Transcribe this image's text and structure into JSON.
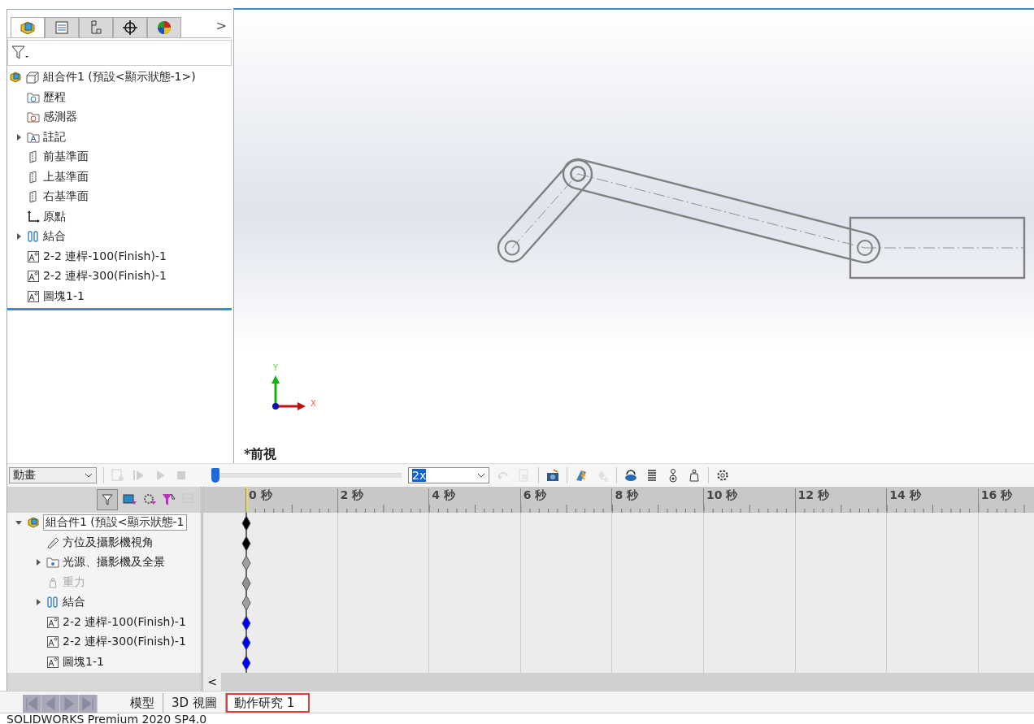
{
  "feature_manager": {
    "tabs": [
      {
        "kind": "feature",
        "selected": true
      },
      {
        "kind": "property",
        "selected": false
      },
      {
        "kind": "config",
        "selected": false
      },
      {
        "kind": "dimxpert",
        "selected": false
      },
      {
        "kind": "display",
        "selected": false
      }
    ],
    "more": ">",
    "tree": [
      {
        "kind": "assembly",
        "label": "組合件1  (預設<顯示狀態-1>)",
        "children": [
          {
            "kind": "history",
            "label": "歷程"
          },
          {
            "kind": "sensor",
            "label": "感測器"
          },
          {
            "kind": "annotation",
            "label": "註記",
            "expanded": false
          },
          {
            "kind": "plane",
            "label": "前基準面"
          },
          {
            "kind": "plane",
            "label": "上基準面"
          },
          {
            "kind": "plane",
            "label": "右基準面"
          },
          {
            "kind": "origin",
            "label": "原點"
          },
          {
            "kind": "mates",
            "label": "結合",
            "expanded": false
          },
          {
            "kind": "part",
            "label": "2-2 連桿-100(Finish)-1"
          },
          {
            "kind": "part",
            "label": "2-2 連桿-300(Finish)-1"
          },
          {
            "kind": "part",
            "label": "圖塊1-1"
          }
        ]
      }
    ]
  },
  "viewport": {
    "view_name": "*前視",
    "triad": {
      "y": "Y",
      "x": "X"
    }
  },
  "motion_study": {
    "study_type": "動畫",
    "timeline_slider": {
      "level": 0
    },
    "playback_speed": "2x",
    "tree": [
      {
        "kind": "assembly",
        "label": "組合件1  (預設<顯示狀態-1",
        "expanded": true,
        "color": "#000000",
        "children": [
          {
            "kind": "camera",
            "label": "方位及攝影機視角",
            "color": "#000000"
          },
          {
            "kind": "lights",
            "label": "光源、攝影機及全景",
            "expanded": false,
            "color": "#a0a0a0"
          },
          {
            "kind": "gravity",
            "label": "重力",
            "disabled": true,
            "color": "#909090"
          },
          {
            "kind": "mates",
            "label": "結合",
            "expanded": false,
            "color": "#a0a0a0"
          },
          {
            "kind": "part",
            "label": "2-2 連桿-100(Finish)-1",
            "color": "#0000ff"
          },
          {
            "kind": "part",
            "label": "2-2 連桿-300(Finish)-1",
            "color": "#0000ff"
          },
          {
            "kind": "part",
            "label": "圖塊1-1",
            "color": "#0000ff"
          }
        ]
      }
    ],
    "time_ticks": [
      "0 秒",
      "2 秒",
      "4 秒",
      "6 秒",
      "8 秒",
      "10 秒",
      "12 秒",
      "14 秒",
      "16 秒"
    ],
    "scroll_left": "<"
  },
  "bottom_tabs": [
    {
      "label": "模型",
      "selected": false
    },
    {
      "label": "3D 視圖",
      "selected": false
    },
    {
      "label": "動作研究 1",
      "selected": true
    }
  ],
  "status_bar": "SOLIDWORKS Premium 2020 SP4.0"
}
